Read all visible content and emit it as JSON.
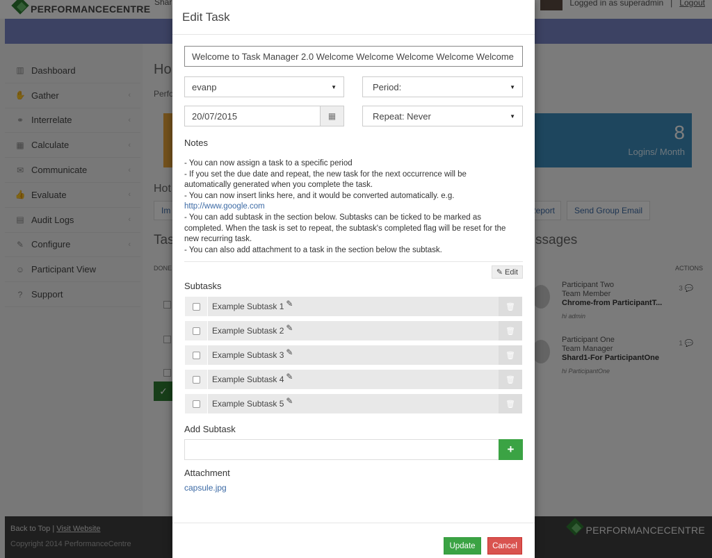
{
  "background": {
    "brand": "PERFORMANCECENTRE",
    "top_user_text": "Shar",
    "logged_in": "Logged in as superadmin",
    "logout": "Logout",
    "sidebar": [
      {
        "label": "Dashboard",
        "icon": "bar-chart-icon",
        "glyph": "▥",
        "chevron": false
      },
      {
        "label": "Gather",
        "icon": "thumb-icon",
        "glyph": "✋",
        "chevron": true
      },
      {
        "label": "Interrelate",
        "icon": "link-icon",
        "glyph": "⚭",
        "chevron": true
      },
      {
        "label": "Calculate",
        "icon": "table-icon",
        "glyph": "▦",
        "chevron": true
      },
      {
        "label": "Communicate",
        "icon": "comments-icon",
        "glyph": "✉",
        "chevron": true
      },
      {
        "label": "Evaluate",
        "icon": "thumbs-up-icon",
        "glyph": "👍",
        "chevron": true
      },
      {
        "label": "Audit Logs",
        "icon": "file-icon",
        "glyph": "▤",
        "chevron": true
      },
      {
        "label": "Configure",
        "icon": "wrench-icon",
        "glyph": "✎",
        "chevron": true
      },
      {
        "label": "Participant View",
        "icon": "user-icon",
        "glyph": "☺",
        "chevron": false
      },
      {
        "label": "Support",
        "icon": "question-icon",
        "glyph": "?",
        "chevron": false
      }
    ],
    "page_title": "Hor",
    "page_sub": "Perfo",
    "card": {
      "value": "8",
      "label": "Logins/ Month"
    },
    "hot_title": "Hot",
    "btn_im": "Im",
    "btn_report": "Report",
    "btn_send_group": "Send Group Email",
    "tasks_title": "Tas",
    "messages_title": "ssages",
    "col_done": "DONE",
    "col_actions": "ACTIONS",
    "messages": [
      {
        "name": "Participant Two",
        "role": "Team Member",
        "subject": "Chrome-from ParticipantT...",
        "preview": "hi admin",
        "count": "3"
      },
      {
        "name": "Participant One",
        "role": "Team Manager",
        "subject": "Shard1-For ParticipantOne",
        "preview": "hi ParticipantOne",
        "count": "1"
      }
    ],
    "footer": {
      "back_to_top": "Back to Top",
      "sep": "|",
      "visit": "Visit Website",
      "copyright": "Copyright 2014 PerformanceCentre"
    }
  },
  "modal": {
    "title": "Edit Task",
    "task_title_value": "Welcome to Task Manager 2.0 Welcome Welcome Welcome Welcome Welcome",
    "assignee": "evanp",
    "period": "Period:",
    "due_date": "20/07/2015",
    "repeat": "Repeat: Never",
    "notes_label": "Notes",
    "notes_lines": [
      "- You can now assign a task to a specific period",
      "- If you set the due date and repeat, the new task for the next occurrence will be",
      "automatically generated when you complete the task.",
      "- You can now insert links here, and it would be converted automatically. e.g.",
      "http://www.google.com",
      "- You can add subtask in the section below. Subtasks can be ticked to be marked as",
      "completed. When the task is set to repeat, the subtask's completed flag will be reset for the",
      "new recurring task.",
      "- You can also add attachment to a task in the section below the subtask."
    ],
    "edit_label": "Edit",
    "subtasks_label": "Subtasks",
    "subtasks": [
      {
        "label": "Example Subtask 1"
      },
      {
        "label": "Example Subtask 2"
      },
      {
        "label": "Example Subtask 3"
      },
      {
        "label": "Example Subtask 4"
      },
      {
        "label": "Example Subtask 5"
      }
    ],
    "add_subtask_label": "Add Subtask",
    "add_subtask_placeholder": "",
    "attachment_label": "Attachment",
    "attachment_file": "capsule.jpg",
    "update_label": "Update",
    "cancel_label": "Cancel"
  },
  "colors": {
    "accent_green": "#3ba344",
    "danger_red": "#d9534f",
    "band_blue": "#7985c7",
    "card_blue": "#3c8dbc"
  }
}
